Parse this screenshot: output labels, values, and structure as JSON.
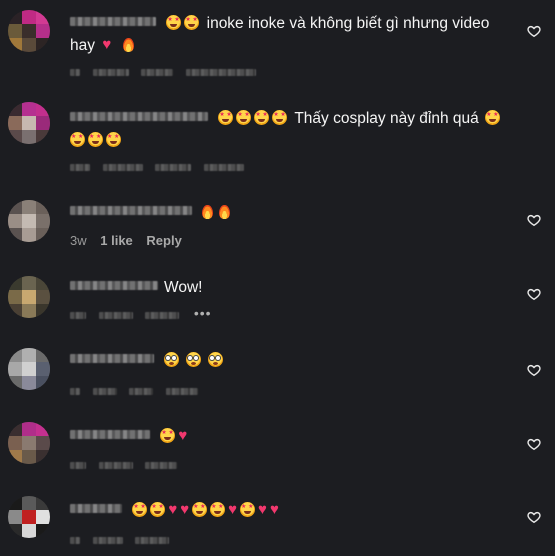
{
  "comments": [
    {
      "text": "inoke inoke và không biết gì nhưng video",
      "text_line2": "hay",
      "meta": {
        "blurred": true
      },
      "emoji_before": [
        "starface",
        "starface"
      ],
      "emoji_after": [
        "heart",
        "fire"
      ]
    },
    {
      "text": "Thấy cosplay này đỉnh quá",
      "emoji_before": [
        "starface",
        "starface",
        "starface",
        "starface"
      ],
      "emoji_after": [
        "starface"
      ],
      "emoji_line2": [
        "starface",
        "starface",
        "starface"
      ]
    },
    {
      "text": "",
      "emoji_after": [
        "fire",
        "fire"
      ],
      "meta": {
        "time": "3w",
        "likes": "1 like",
        "reply": "Reply"
      }
    },
    {
      "text": "Wow!",
      "more_icon": "ellipsis-icon"
    },
    {
      "text": "",
      "emoji_after": [
        "flushed",
        "flushed",
        "flushed"
      ]
    },
    {
      "text": "",
      "emoji_after": [
        "starface",
        "heart"
      ]
    },
    {
      "text": "",
      "emoji_after": [
        "starface",
        "starface",
        "heart",
        "heart",
        "starface",
        "starface",
        "heart",
        "starface",
        "heart",
        "heart"
      ]
    }
  ],
  "colors": {
    "background": "#1c1d21",
    "text": "#f5f5f5",
    "meta_text": "#9a9a9a",
    "heart_emoji": "#f2386e"
  },
  "icons": {
    "like": "heart-outline-icon",
    "more": "ellipsis-icon"
  }
}
